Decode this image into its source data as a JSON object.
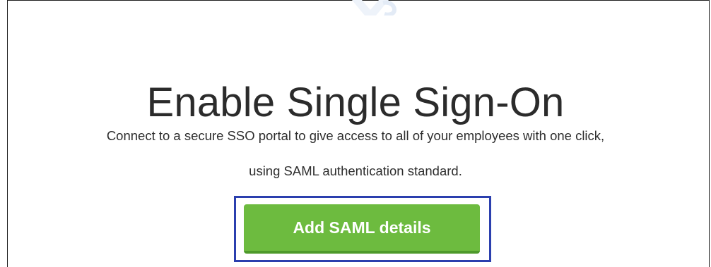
{
  "page": {
    "title": "Enable Single Sign-On",
    "description_line1": "Connect to a secure SSO portal to give access to all of your employees with one click,",
    "description_line2": "using SAML authentication standard."
  },
  "actions": {
    "add_saml_label": "Add SAML details"
  },
  "icons": {
    "top_decoration": "decorative-shape-icon"
  },
  "colors": {
    "accent_green": "#6dbb3f",
    "highlight_blue": "#2b3fae",
    "title_text": "#2b2b2b"
  }
}
